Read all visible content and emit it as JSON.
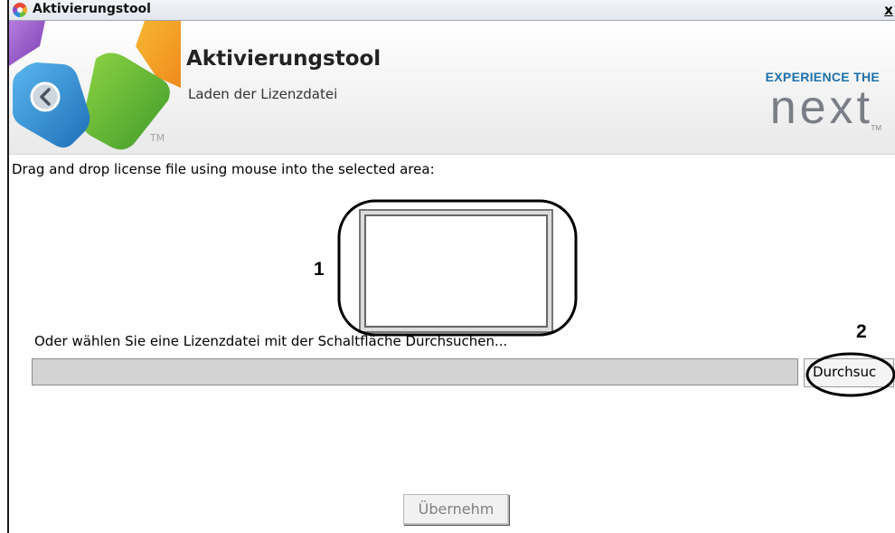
{
  "window": {
    "title": "Aktivierungstool",
    "close_label": "x"
  },
  "header": {
    "title": "Aktivierungstool",
    "subtitle": "Laden der Lizenzdatei",
    "logo_tm": "TM",
    "brand_line": "EXPERIENCE THE",
    "brand_word": "next",
    "brand_tm": "TM"
  },
  "content": {
    "instruction": "Drag and drop license file using mouse into the selected area:",
    "callout_1": "1",
    "callout_2": "2",
    "alt_instruction": "Oder wählen Sie eine Lizenzdatei mit der Schaltfläche Durchsuchen...",
    "file_path_value": "",
    "browse_label": "Durchsuc",
    "apply_label": "Übernehm"
  },
  "colors": {
    "brand_blue": "#1d6fa8",
    "brand_gray": "#7a7e86",
    "field_bg": "#d3d3d3"
  }
}
